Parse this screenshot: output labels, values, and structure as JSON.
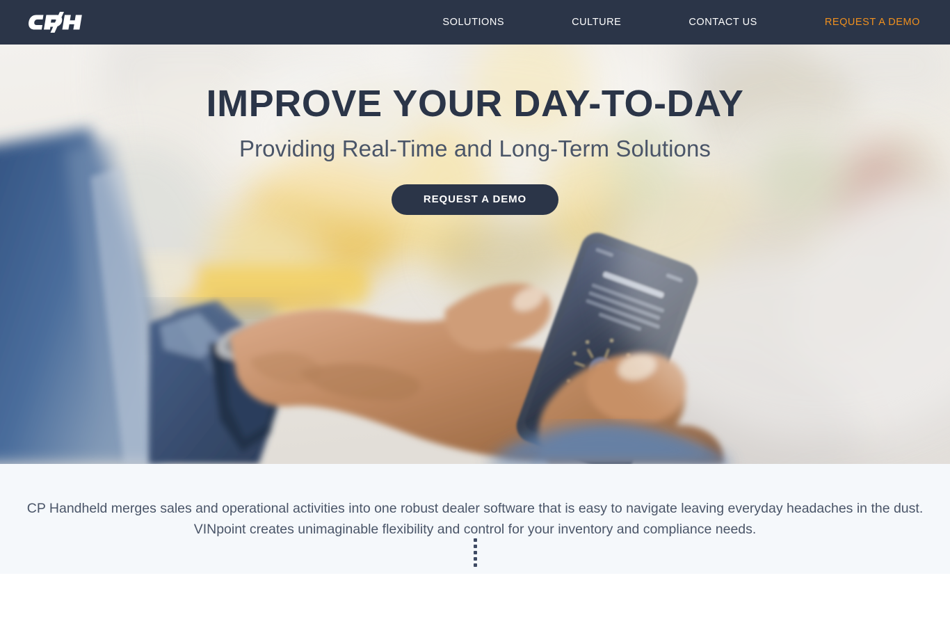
{
  "brand": {
    "logo_text": "CPH",
    "logo_name": "cph-logo"
  },
  "header": {
    "background_color": "#2b3548",
    "nav": [
      {
        "label": "SOLUTIONS",
        "name": "nav-solutions",
        "accent": false
      },
      {
        "label": "CULTURE",
        "name": "nav-culture",
        "accent": false
      },
      {
        "label": "CONTACT US",
        "name": "nav-contact-us",
        "accent": false
      },
      {
        "label": "REQUEST A DEMO",
        "name": "nav-request-a-demo",
        "accent": true
      }
    ],
    "accent_color": "#f0901e"
  },
  "hero": {
    "title": "IMPROVE YOUR DAY-TO-DAY",
    "subtitle": "Providing Real-Time and Long-Term Solutions",
    "cta_label": "REQUEST A DEMO",
    "title_color": "#2b3548",
    "cta_background": "#2b3548",
    "image_description": "blurred city street with businessman hands holding a smartphone",
    "phone_screen_text": "Try VINpoint for free"
  },
  "intro": {
    "line1": "CP Handheld merges sales and operational activities into one robust dealer software that is easy to navigate leaving everyday headaches in the dust.",
    "line2": "VINpoint creates unimaginable flexibility and control for your inventory and compliance needs.",
    "background_color": "#f5f8fb",
    "text_color": "#4a5568"
  },
  "scroll_indicator": {
    "name": "scroll-down-dots",
    "dot_count": 5,
    "color": "#3e4a63"
  }
}
